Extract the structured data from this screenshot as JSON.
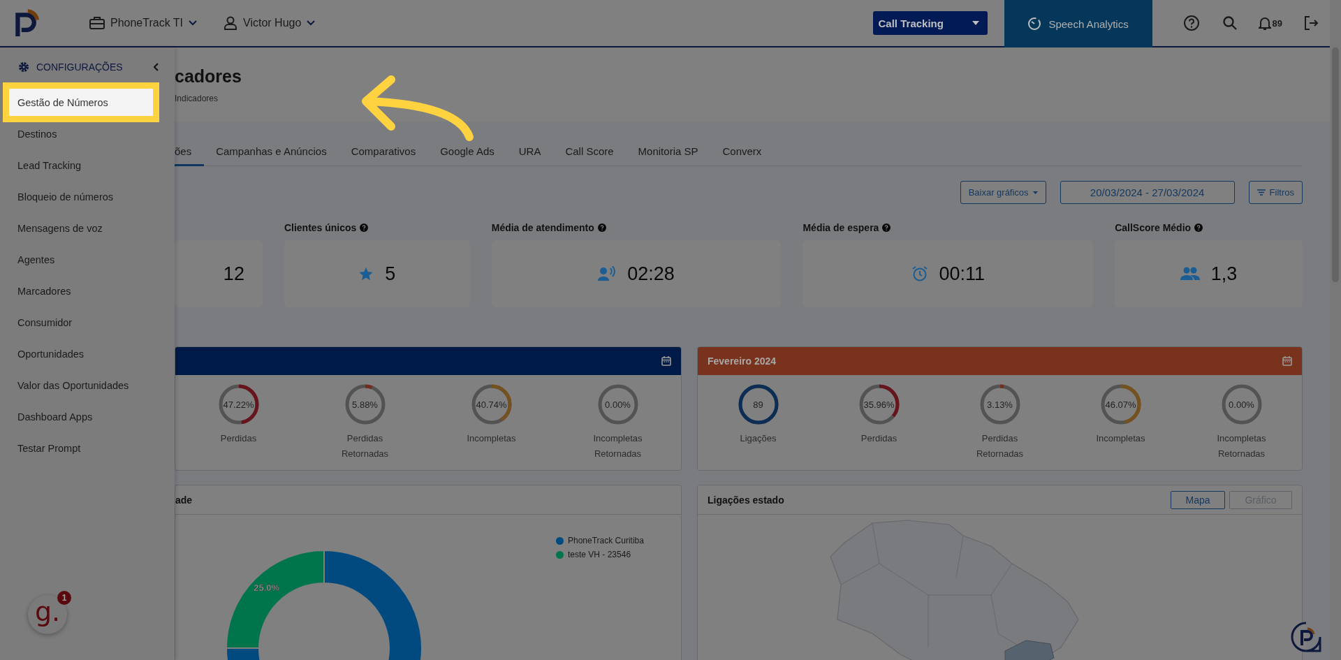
{
  "header": {
    "workspace": "PhoneTrack TI",
    "user": "Victor Hugo",
    "product_select": "Call Tracking",
    "speech_analytics": "Speech Analytics",
    "notifications": "89"
  },
  "sidebar": {
    "title": "CONFIGURAÇÕES",
    "items": [
      {
        "label": "Gestão de Números",
        "highlighted": true
      },
      {
        "label": "Destinos",
        "highlighted": false
      },
      {
        "label": "Lead Tracking",
        "highlighted": false
      },
      {
        "label": "Bloqueio de números",
        "highlighted": false
      },
      {
        "label": "Mensagens de voz",
        "highlighted": false
      },
      {
        "label": "Agentes",
        "highlighted": false
      },
      {
        "label": "Marcadores",
        "highlighted": false
      },
      {
        "label": "Consumidor",
        "highlighted": false
      },
      {
        "label": "Oportunidades",
        "highlighted": false
      },
      {
        "label": "Valor das Oportunidades",
        "highlighted": false
      },
      {
        "label": "Dashboard Apps",
        "highlighted": false
      },
      {
        "label": "Testar Prompt",
        "highlighted": false
      }
    ]
  },
  "page": {
    "title": "cadores",
    "breadcrumb": "Indicadores"
  },
  "tabs": [
    {
      "label": "ões",
      "selected": true
    },
    {
      "label": "Campanhas e Anúncios",
      "selected": false
    },
    {
      "label": "Comparativos",
      "selected": false
    },
    {
      "label": "Google Ads",
      "selected": false
    },
    {
      "label": "URA",
      "selected": false
    },
    {
      "label": "Call Score",
      "selected": false
    },
    {
      "label": "Monitoria SP",
      "selected": false
    },
    {
      "label": "Converx",
      "selected": false
    }
  ],
  "toolbar": {
    "download": "Baixar gráficos",
    "date_range": "20/03/2024 - 27/03/2024",
    "filters": "Filtros"
  },
  "kpis": [
    {
      "kind": "none",
      "value": "12"
    },
    {
      "kind": "star",
      "label": "Clientes únicos",
      "value": "5"
    },
    {
      "kind": "voice",
      "label": "Média de atendimento",
      "value": "02:28"
    },
    {
      "kind": "alarm",
      "label": "Média de espera",
      "value": "00:11"
    },
    {
      "kind": "group",
      "label": "CallScore Médio",
      "value": "1,3"
    }
  ],
  "month_panels": [
    {
      "color": "#001a48",
      "gauges": [
        {
          "value": "47.22%",
          "label": "Perdidas",
          "level": 0.4722,
          "color": "#68141d"
        },
        {
          "value": "5.88%",
          "label": "Perdidas Retornadas",
          "level": 0.0588,
          "color": "#742c1d"
        },
        {
          "value": "40.74%",
          "label": "Incompletas",
          "level": 0.4074,
          "color": "#74511d"
        },
        {
          "value": "0.00%",
          "label": "Incompletas Retornadas"
        }
      ]
    },
    {
      "title": "Fevereiro 2024",
      "color": "#79321c",
      "gauges": [
        {
          "value": "89",
          "label": "Ligações",
          "level": 1,
          "color": "#0d2e54"
        },
        {
          "value": "35.96%",
          "label": "Perdidas",
          "level": 0.3596,
          "color": "#68141d"
        },
        {
          "value": "3.13%",
          "label": "Perdidas Retornadas",
          "level": 0.0313,
          "color": "#742c1d"
        },
        {
          "value": "46.07%",
          "label": "Incompletas",
          "level": 0.4607,
          "color": "#74511d"
        },
        {
          "value": "0.00%",
          "label": "Incompletas Retornadas"
        }
      ]
    }
  ],
  "donut_panel": {
    "title": "ade",
    "slice_label": "25.0%",
    "chart_data": {
      "type": "donut",
      "categories": [
        "PhoneTrack Curitiba",
        "teste VH - 23546"
      ],
      "values": [
        75,
        25
      ],
      "colors": [
        "#004a80",
        "#00744a"
      ]
    }
  },
  "map_panel": {
    "title": "Ligações estado",
    "toggles": [
      {
        "label": "Mapa",
        "selected": true
      },
      {
        "label": "Gráfico",
        "selected": false
      }
    ]
  },
  "chat_widget": {
    "logo": "g.",
    "badge": "1"
  }
}
